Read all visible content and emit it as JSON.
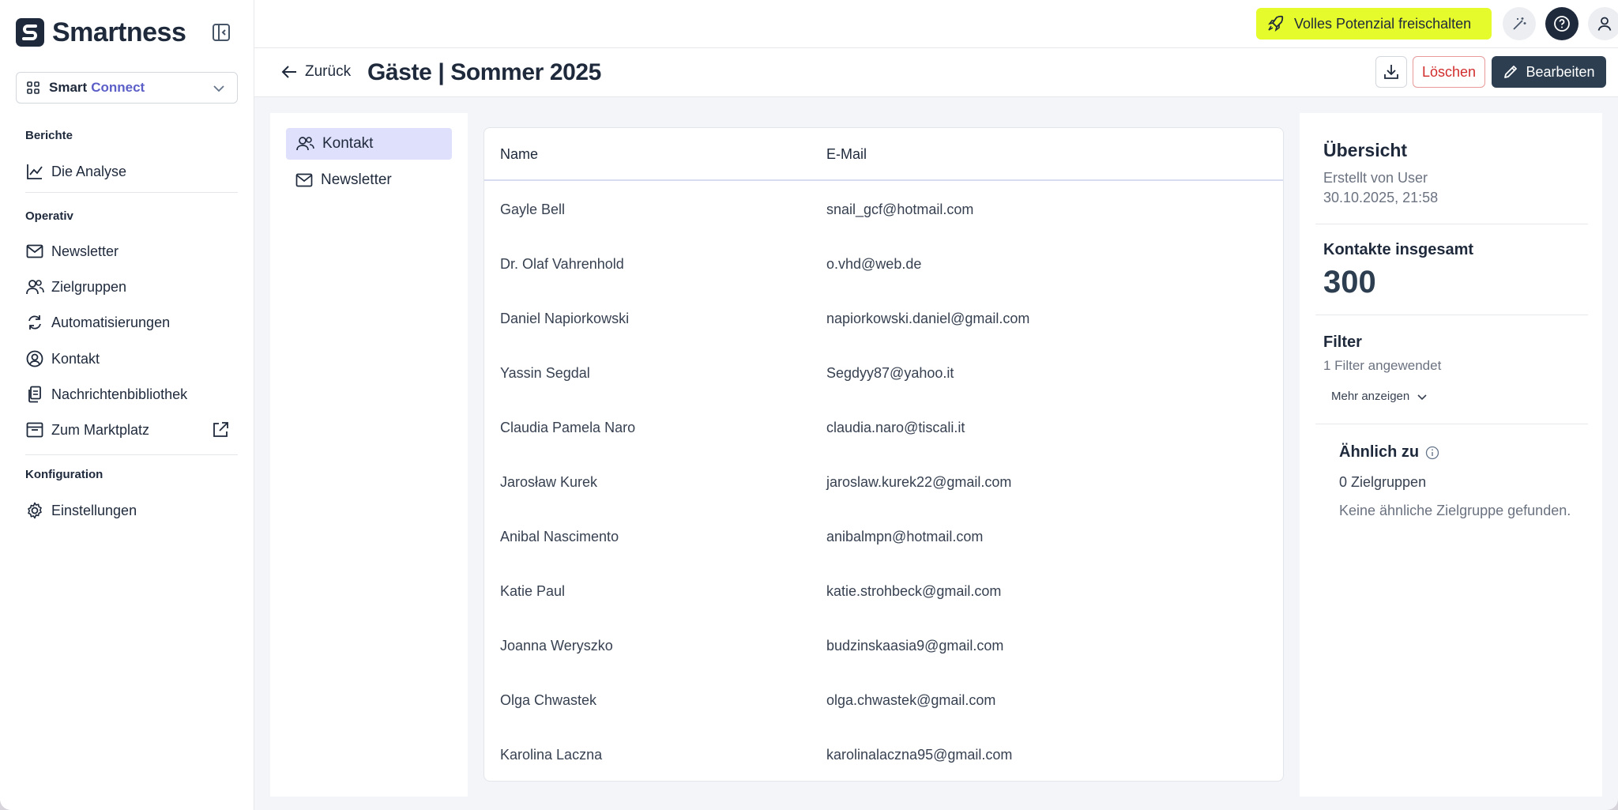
{
  "brand": {
    "name": "Smartness"
  },
  "product_switcher": {
    "name_part1": "Smart",
    "name_part2": "Connect"
  },
  "sidebar": {
    "groups": [
      {
        "label": "Berichte",
        "items": [
          {
            "label": "Die Analyse",
            "icon": "chart-line-icon"
          }
        ]
      },
      {
        "label": "Operativ",
        "items": [
          {
            "label": "Newsletter",
            "icon": "mail-icon"
          },
          {
            "label": "Zielgruppen",
            "icon": "users-icon"
          },
          {
            "label": "Automatisierungen",
            "icon": "refresh-icon"
          },
          {
            "label": "Kontakt",
            "icon": "user-circle-icon"
          },
          {
            "label": "Nachrichtenbibliothek",
            "icon": "documents-icon"
          },
          {
            "label": "Zum Marktplatz",
            "icon": "store-icon"
          }
        ]
      },
      {
        "label": "Konfiguration",
        "items": [
          {
            "label": "Einstellungen",
            "icon": "gear-icon"
          }
        ]
      }
    ]
  },
  "topbar": {
    "upgrade_label": "Volles Potenzial freischalten",
    "accent_color": "#e6fb2b"
  },
  "page": {
    "back_label": "Zurück",
    "title": "Gäste | Sommer 2025",
    "delete_label": "Löschen",
    "edit_label": "Bearbeiten"
  },
  "subnav": [
    {
      "label": "Kontakt",
      "icon": "users-icon",
      "active": true
    },
    {
      "label": "Newsletter",
      "icon": "mail-icon",
      "active": false
    }
  ],
  "table": {
    "columns": [
      "Name",
      "E-Mail"
    ],
    "rows": [
      [
        "Gayle Bell",
        "snail_gcf@hotmail.com"
      ],
      [
        "Dr. Olaf Vahrenhold",
        "o.vhd@web.de"
      ],
      [
        "Daniel Napiorkowski",
        "napiorkowski.daniel@gmail.com"
      ],
      [
        "Yassin Segdal",
        "Segdyy87@yahoo.it"
      ],
      [
        "Claudia Pamela Naro",
        "claudia.naro@tiscali.it"
      ],
      [
        "Jarosław Kurek",
        "jaroslaw.kurek22@gmail.com"
      ],
      [
        "Anibal Nascimento",
        "anibalmpn@hotmail.com"
      ],
      [
        "Katie Paul",
        "katie.strohbeck@gmail.com"
      ],
      [
        "Joanna Weryszko",
        "budzinskaasia9@gmail.com"
      ],
      [
        "Olga Chwastek",
        "olga.chwastek@gmail.com"
      ],
      [
        "Karolina Laczna",
        "karolinalaczna95@gmail.com"
      ]
    ]
  },
  "overview": {
    "title": "Übersicht",
    "created_by": "Erstellt von User",
    "created_at": "30.10.2025, 21:58",
    "total_label": "Kontakte insgesamt",
    "total_value": "300",
    "filter_label": "Filter",
    "filter_applied": "1 Filter angewendet",
    "show_more": "Mehr anzeigen",
    "similar_label": "Ähnlich zu",
    "similar_count": "0 Zielgruppen",
    "similar_empty": "Keine ähnliche Zielgruppe gefunden."
  }
}
